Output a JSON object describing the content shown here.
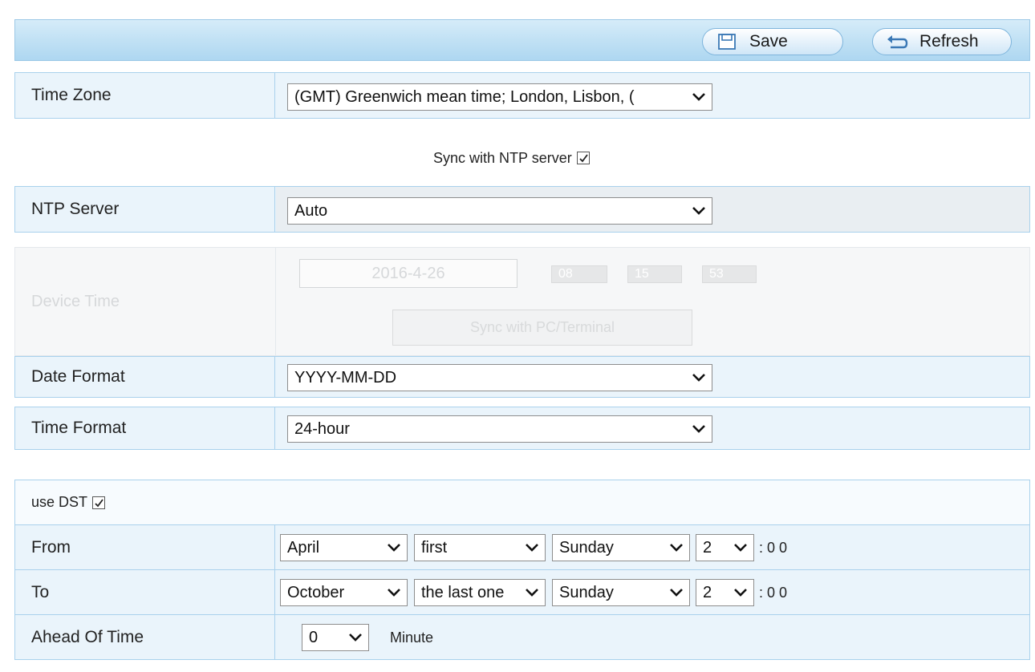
{
  "toolbar": {
    "save_label": "Save",
    "refresh_label": "Refresh"
  },
  "time_zone": {
    "label": "Time Zone",
    "value": "(GMT) Greenwich mean time; London, Lisbon, ("
  },
  "ntp_sync": {
    "label": "Sync with NTP server",
    "checked": true
  },
  "ntp_server": {
    "label": "NTP Server",
    "value": "Auto"
  },
  "device_time": {
    "label": "Device Time",
    "date": "2016-4-26",
    "hour": "08",
    "minute": "15",
    "second": "53",
    "sync_button": "Sync with PC/Terminal"
  },
  "date_format": {
    "label": "Date Format",
    "value": "YYYY-MM-DD"
  },
  "time_format": {
    "label": "Time Format",
    "value": "24-hour"
  },
  "dst": {
    "label": "use DST",
    "checked": true,
    "from": {
      "label": "From",
      "month": "April",
      "week": "first",
      "day": "Sunday",
      "hour": "2",
      "suffix": ": 0 0"
    },
    "to": {
      "label": "To",
      "month": "October",
      "week": "the last one",
      "day": "Sunday",
      "hour": "2",
      "suffix": ": 0 0"
    },
    "ahead": {
      "label": "Ahead Of Time",
      "value": "0",
      "unit": "Minute"
    }
  },
  "colors": {
    "toolbar_bg": "#bfe0f4",
    "row_bg": "#eaf4fb",
    "border": "#a9d1ec"
  }
}
